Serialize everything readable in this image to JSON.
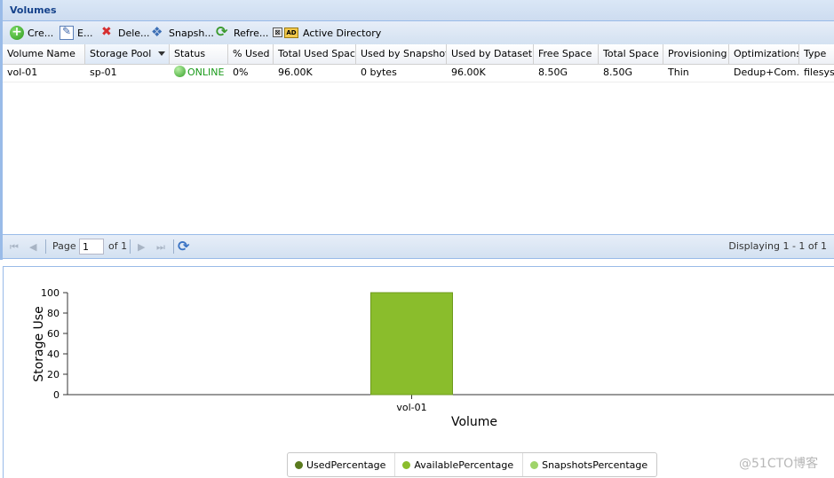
{
  "panel": {
    "title": "Volumes"
  },
  "toolbar": {
    "create": "Cre...",
    "edit": "E...",
    "delete": "Dele...",
    "snapshot": "Snapsh...",
    "refresh": "Refre...",
    "ad_box": "⊠",
    "ad_tag": "AD",
    "active_directory": "Active Directory"
  },
  "grid": {
    "columns": [
      "Volume Name",
      "Storage Pool",
      "Status",
      "% Used",
      "Total Used Space",
      "Used by Snapshots",
      "Used by Dataset",
      "Free Space",
      "Total Space",
      "Provisioning",
      "Optimizations",
      "Type"
    ],
    "rows": [
      {
        "volume_name": "vol-01",
        "storage_pool": "sp-01",
        "status": "ONLINE",
        "pct_used": "0%",
        "total_used": "96.00K",
        "used_by_snapshots": "0 bytes",
        "used_by_dataset": "96.00K",
        "free_space": "8.50G",
        "total_space": "8.50G",
        "provisioning": "Thin",
        "optimizations": "Dedup+Com...",
        "type": "filesystem"
      }
    ]
  },
  "pager": {
    "page_label": "Page",
    "page_value": "1",
    "of_label": "of 1",
    "displaying": "Displaying 1 - 1 of 1"
  },
  "chart_data": {
    "type": "bar",
    "categories": [
      "vol-01"
    ],
    "series": [
      {
        "name": "UsedPercentage",
        "values": [
          0
        ],
        "color": "#5a7a1e"
      },
      {
        "name": "AvailablePercentage",
        "values": [
          100
        ],
        "color": "#8abd2c"
      },
      {
        "name": "SnapshotsPercentage",
        "values": [
          0
        ],
        "color": "#9fd46a"
      }
    ],
    "xlabel": "Volume",
    "ylabel": "Storage Use",
    "ylim": [
      0,
      100
    ],
    "yticks": [
      "0",
      "20",
      "40",
      "60",
      "80",
      "100"
    ],
    "legend": "bottom"
  },
  "watermark": "@51CTO博客"
}
